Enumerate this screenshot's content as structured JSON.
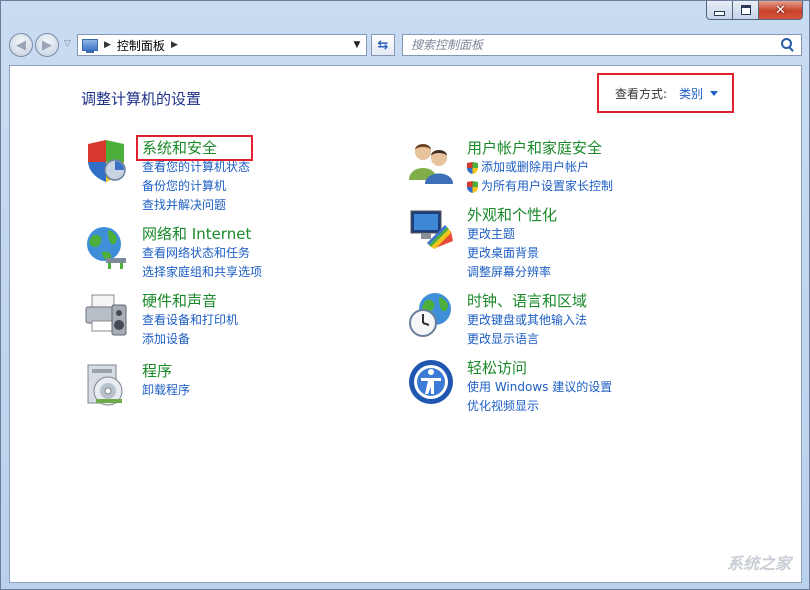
{
  "window": {
    "caption": {
      "minimize": "–",
      "maximize": "□",
      "close": "✕"
    }
  },
  "nav": {
    "breadcrumb": "控制面板",
    "search_placeholder": "搜索控制面板"
  },
  "content": {
    "title": "调整计算机的设置",
    "view_by": {
      "label": "查看方式:",
      "value": "类别"
    },
    "left_categories": [
      {
        "title": "系统和安全",
        "icon": "shield-icon",
        "links": [
          "查看您的计算机状态",
          "备份您的计算机",
          "查找并解决问题"
        ]
      },
      {
        "title": "网络和 Internet",
        "icon": "network-globe-icon",
        "links": [
          "查看网络状态和任务",
          "选择家庭组和共享选项"
        ]
      },
      {
        "title": "硬件和声音",
        "icon": "printer-speaker-icon",
        "links": [
          "查看设备和打印机",
          "添加设备"
        ]
      },
      {
        "title": "程序",
        "icon": "programs-disc-icon",
        "links": [
          "卸载程序"
        ]
      }
    ],
    "right_categories": [
      {
        "title": "用户帐户和家庭安全",
        "icon": "users-icon",
        "links": [
          "添加或删除用户帐户",
          "为所有用户设置家长控制"
        ]
      },
      {
        "title": "外观和个性化",
        "icon": "monitor-palette-icon",
        "links": [
          "更改主题",
          "更改桌面背景",
          "调整屏幕分辨率"
        ]
      },
      {
        "title": "时钟、语言和区域",
        "icon": "clock-globe-icon",
        "links": [
          "更改键盘或其他输入法",
          "更改显示语言"
        ]
      },
      {
        "title": "轻松访问",
        "icon": "ease-of-access-icon",
        "links": [
          "使用 Windows 建议的设置",
          "优化视频显示"
        ]
      }
    ]
  },
  "watermark": "系统之家",
  "colors": {
    "link": "#1d5ec5",
    "category_title": "#19892a",
    "highlight_box": "#e0202e",
    "page_title": "#1e3287"
  }
}
